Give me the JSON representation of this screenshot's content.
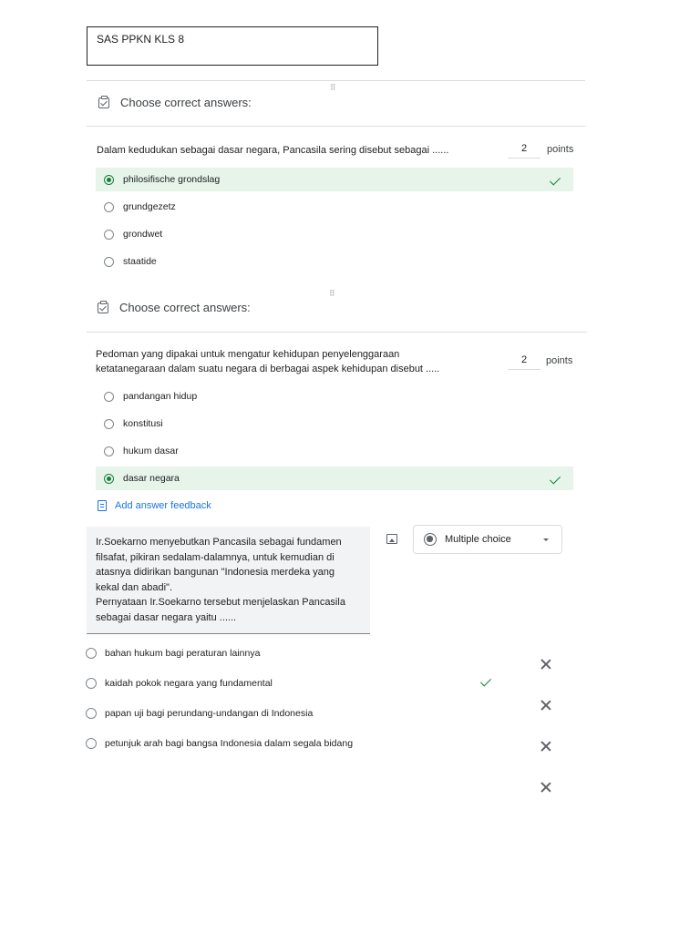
{
  "title": "SAS PPKN KLS 8",
  "drag_handle_glyph": "⠿",
  "question1": {
    "section_label": "Choose correct answers:",
    "text": "Dalam kedudukan sebagai dasar negara, Pancasila sering disebut sebagai ......",
    "points_value": "2",
    "points_label": "points",
    "options": [
      "philosifische grondslag",
      "grundgezetz",
      "grondwet",
      "staatide"
    ],
    "correct_option": "philosifische grondslag"
  },
  "question2": {
    "section_label": "Choose correct answers:",
    "text_lines": [
      "Pedoman yang dipakai untuk mengatur kehidupan penyelenggaraan",
      "ketatanegaraan dalam suatu negara di berbagai aspek kehidupan disebut ....."
    ],
    "points_value": "2",
    "points_label": "points",
    "options": [
      "pandangan hidup",
      "konstitusi",
      "hukum dasar",
      "dasar negara"
    ],
    "correct_option": "dasar negara",
    "feedback_label": "Add answer feedback"
  },
  "question3": {
    "text_lines": [
      "Ir.Soekarno menyebutkan Pancasila sebagai fundamen",
      "filsafat, pikiran sedalam-dalamnya, untuk kemudian di",
      "atasnya didirikan bangunan \"Indonesia merdeka yang",
      "kekal dan abadi\".",
      "Pernyataan Ir.Soekarno tersebut menjelaskan Pancasila",
      "sebagai dasar negara yaitu ......"
    ],
    "question_type": "Multiple choice",
    "options": [
      "bahan hukum bagi peraturan lainnya",
      "kaidah pokok negara yang fundamental",
      "papan uji bagi perundang-undangan di Indonesia",
      "petunjuk arah bagi bangsa Indonesia dalam segala bidang"
    ],
    "correct_option": "kaidah pokok negara yang fundamental"
  },
  "icons": {
    "section_icon": "checkbox-checked-icon",
    "correct_icon": "check-icon",
    "remove_icon": "close-icon",
    "feedback_icon": "feedback-clipboard-icon",
    "image_icon": "add-image-icon",
    "type_icon": "radio-button-icon",
    "dropdown_icon": "dropdown-caret-icon"
  },
  "colors": {
    "correct_bg": "#e6f4ea",
    "correct_accent": "#188038",
    "link_blue": "#1a73e8"
  }
}
